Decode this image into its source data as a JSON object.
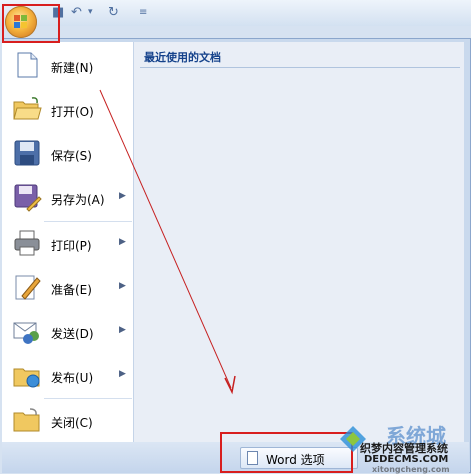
{
  "recent": {
    "title": "最近使用的文档"
  },
  "menu_items": [
    {
      "label": "新建(N)",
      "icon": "new-document-icon",
      "has_submenu": false
    },
    {
      "label": "打开(O)",
      "icon": "open-folder-icon",
      "has_submenu": false
    },
    {
      "label": "保存(S)",
      "icon": "save-disk-icon",
      "has_submenu": false
    },
    {
      "label": "另存为(A)",
      "icon": "save-as-icon",
      "has_submenu": true
    },
    {
      "label": "打印(P)",
      "icon": "printer-icon",
      "has_submenu": true
    },
    {
      "label": "准备(E)",
      "icon": "prepare-pen-icon",
      "has_submenu": true
    },
    {
      "label": "发送(D)",
      "icon": "send-mail-icon",
      "has_submenu": true
    },
    {
      "label": "发布(U)",
      "icon": "publish-folder-icon",
      "has_submenu": true
    },
    {
      "label": "关闭(C)",
      "icon": "close-folder-icon",
      "has_submenu": false
    }
  ],
  "footer": {
    "word_options_label": "Word 选项"
  },
  "watermark": {
    "brand": "系统城",
    "site1": "织梦内容管理系统",
    "site2": "DEDECMS.COM",
    "site3": "xitongcheng.com"
  },
  "colors": {
    "highlight_box": "#d81e1e",
    "arrow": "#c62020",
    "office_orange": "#f4b23c"
  }
}
